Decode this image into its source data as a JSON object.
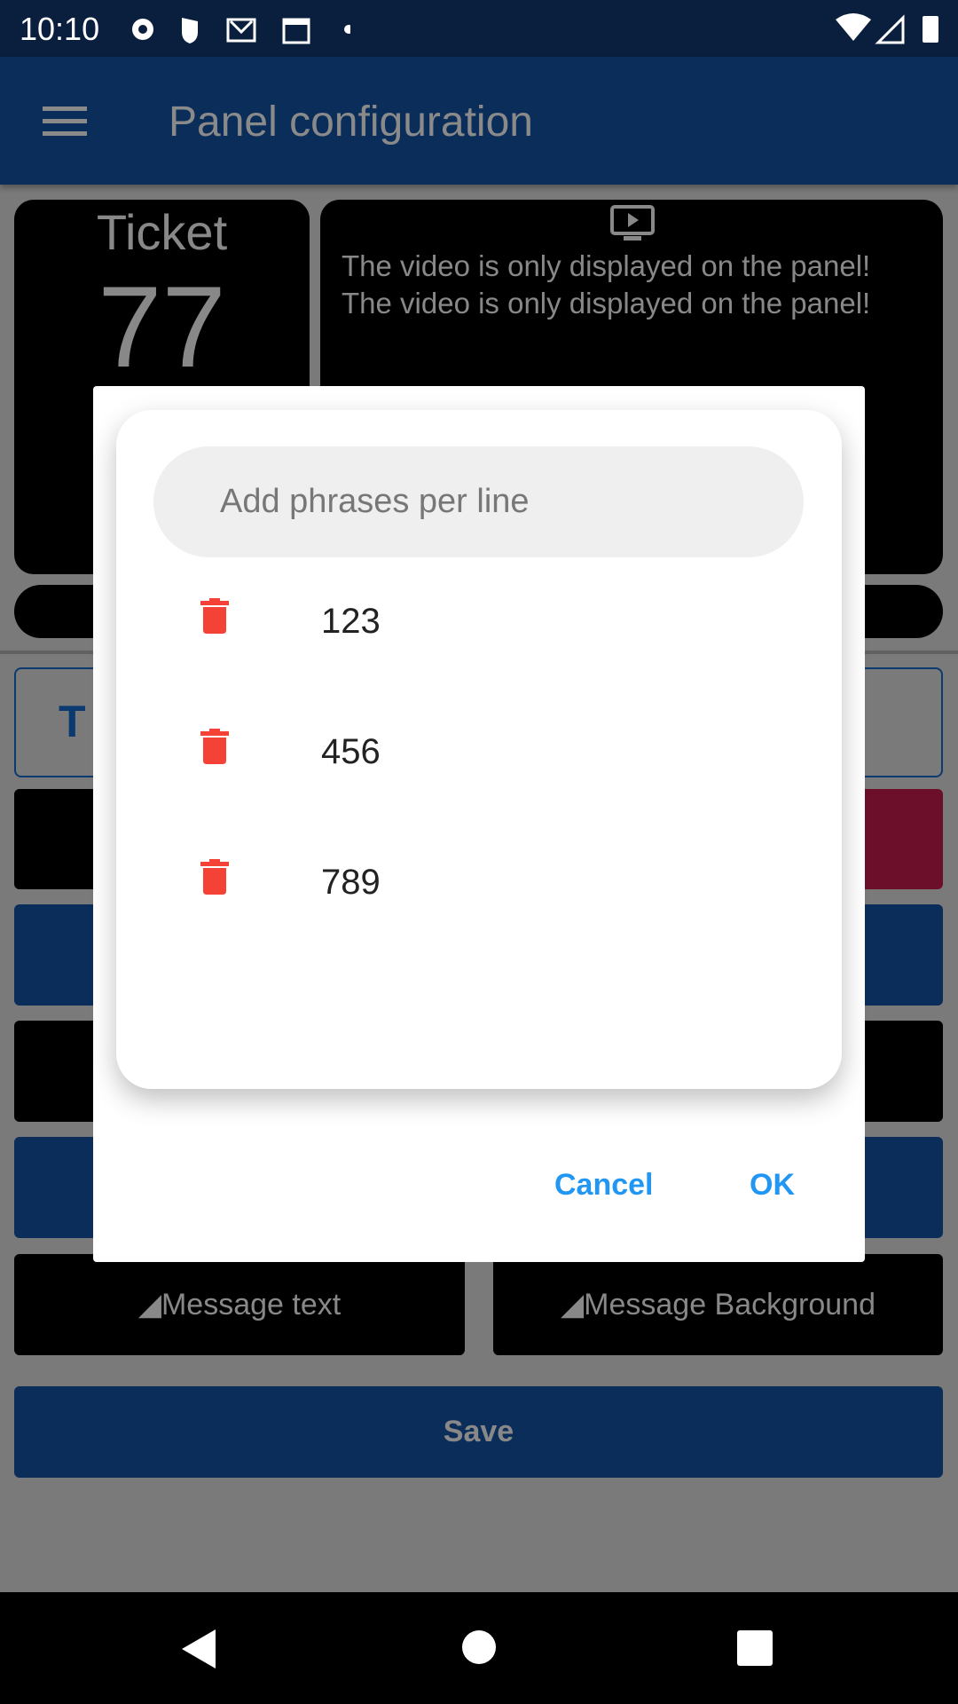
{
  "status_bar": {
    "time": "10:10",
    "icons": [
      "gear-icon",
      "shield-icon",
      "gmail-icon",
      "calendar-icon",
      "dot-icon",
      "wifi-icon",
      "signal-icon",
      "battery-icon"
    ]
  },
  "app_bar": {
    "title": "Panel configuration",
    "menu_icon": "hamburger-icon"
  },
  "preview": {
    "ticket_label": "Ticket",
    "ticket_number": "77",
    "video_icon": "video-icon",
    "video_lines": [
      "The video is only displayed on the panel!",
      "The video is only displayed on the panel!"
    ]
  },
  "background": {
    "tab_initial": "T",
    "message_text_button": "Message text",
    "message_background_button": "Message Background",
    "save_button": "Save"
  },
  "dialog": {
    "input_placeholder": "Add phrases per line",
    "phrases": [
      "123",
      "456",
      "789"
    ],
    "cancel": "Cancel",
    "ok": "OK"
  },
  "colors": {
    "accent": "#2196f3",
    "delete": "#f44336",
    "primary": "#0d47a1"
  }
}
